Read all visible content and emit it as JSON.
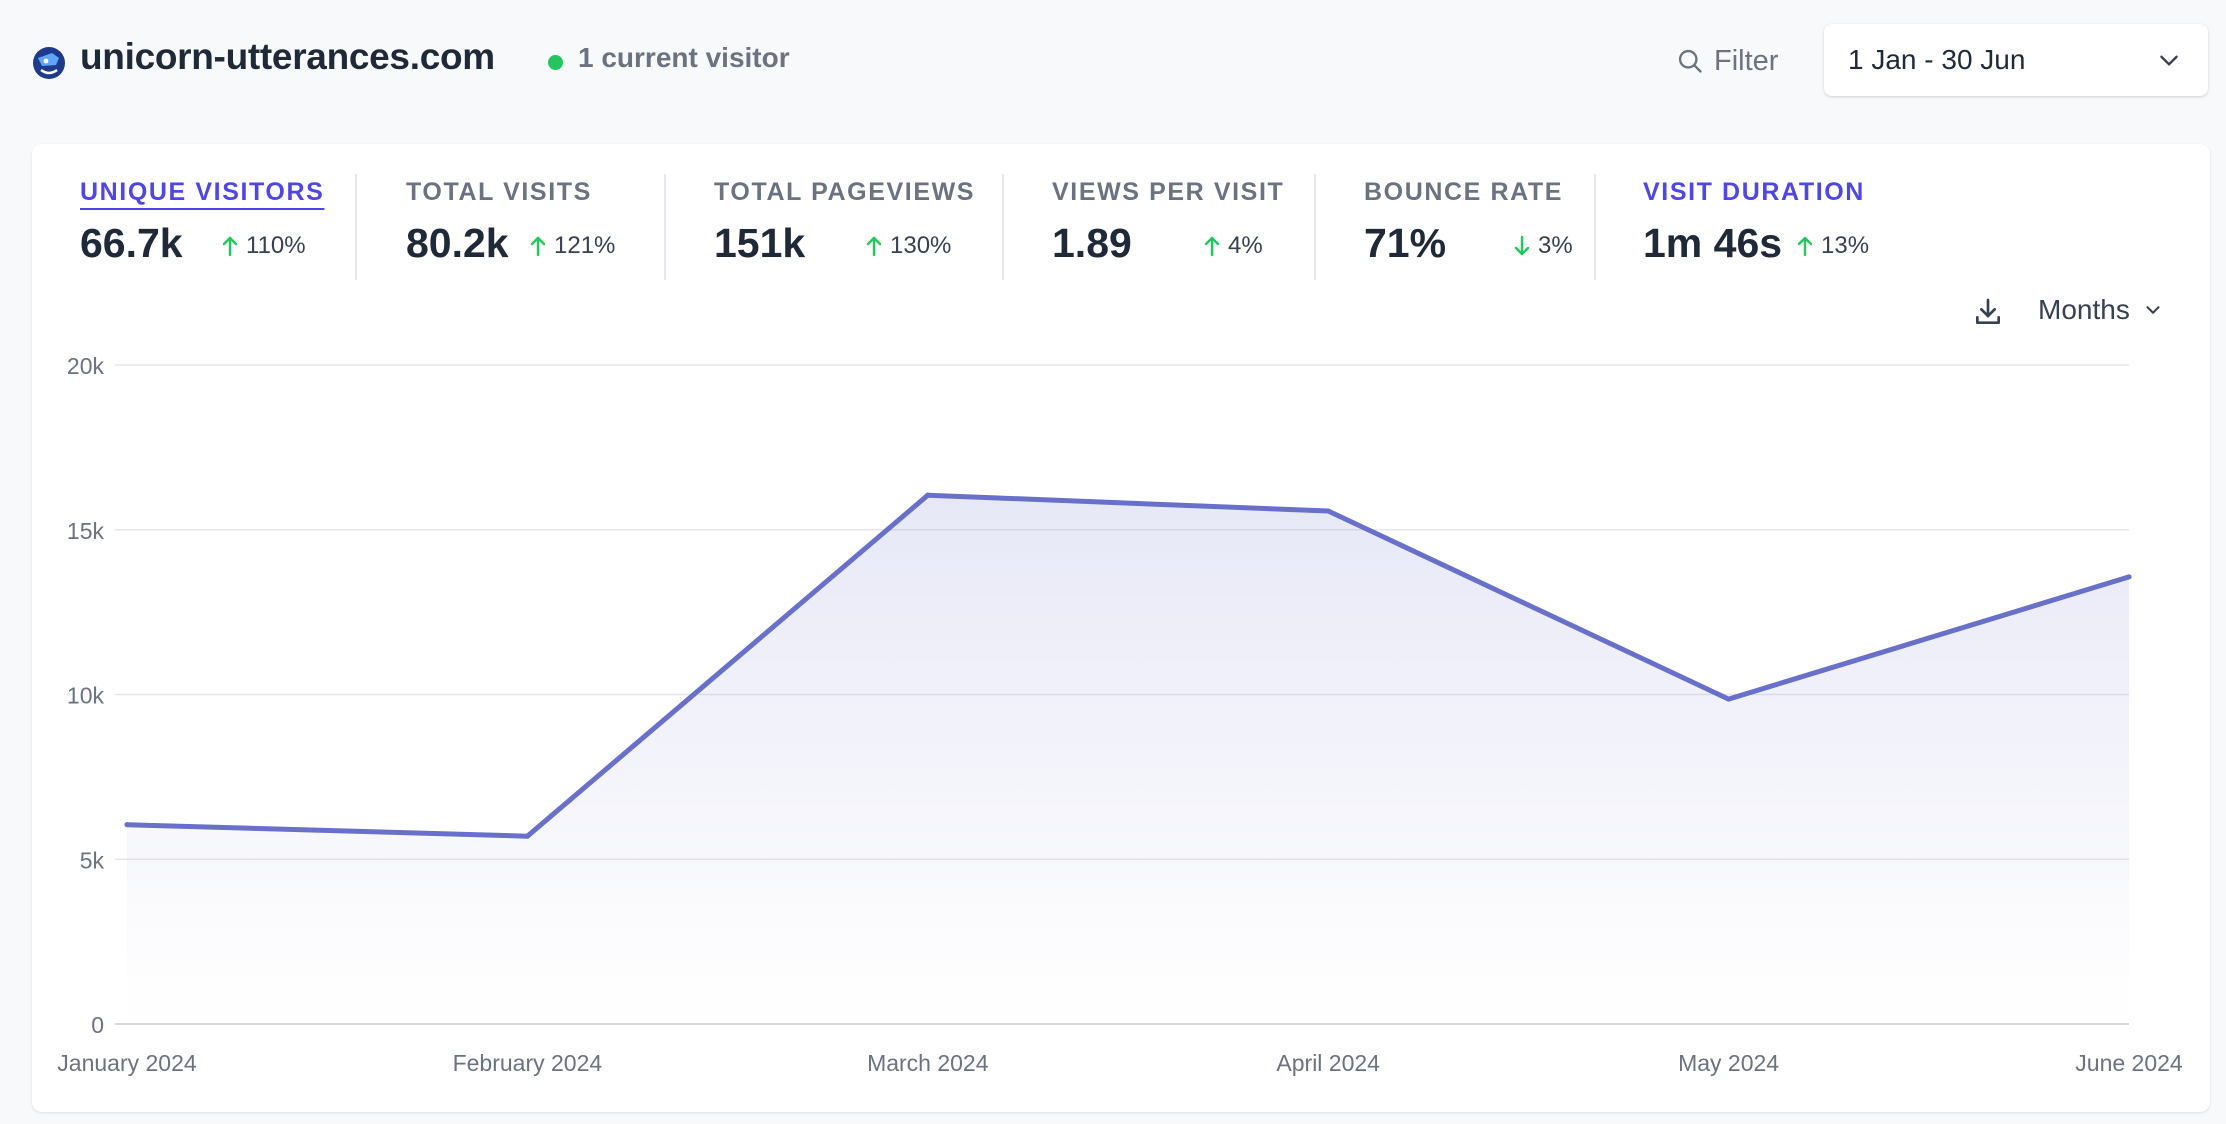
{
  "header": {
    "favicon_icon": "unicorn-favicon-icon",
    "site_name": "unicorn-utterances.com",
    "current_visitors": "1 current visitor",
    "filter_label": "Filter",
    "date_range": "1 Jan - 30 Jun"
  },
  "stats": [
    {
      "label": "UNIQUE VISITORS",
      "value": "66.7k",
      "change": "110%",
      "direction": "up"
    },
    {
      "label": "TOTAL VISITS",
      "value": "80.2k",
      "change": "121%",
      "direction": "up"
    },
    {
      "label": "TOTAL PAGEVIEWS",
      "value": "151k",
      "change": "130%",
      "direction": "up"
    },
    {
      "label": "VIEWS PER VISIT",
      "value": "1.89",
      "change": "4%",
      "direction": "up"
    },
    {
      "label": "BOUNCE RATE",
      "value": "71%",
      "change": "3%",
      "direction": "down"
    },
    {
      "label": "VISIT DURATION",
      "value": "1m 46s",
      "change": "13%",
      "direction": "up"
    }
  ],
  "chart_controls": {
    "download_icon": "download-icon",
    "interval_label": "Months"
  },
  "colors": {
    "accent": "#4f46e5",
    "line": "#6870c9",
    "live": "#22c55e",
    "up": "#22c55e",
    "down": "#22c55e"
  },
  "chart_data": {
    "type": "area",
    "categories": [
      "January 2024",
      "February 2024",
      "March 2024",
      "April 2024",
      "May 2024",
      "June 2024"
    ],
    "series": [
      {
        "values": [
          6050,
          5700,
          16050,
          15570,
          9860,
          13570
        ]
      }
    ],
    "y_ticks": [
      "0",
      "5k",
      "10k",
      "15k",
      "20k"
    ],
    "ylim": [
      0,
      20000
    ],
    "grid": true
  }
}
